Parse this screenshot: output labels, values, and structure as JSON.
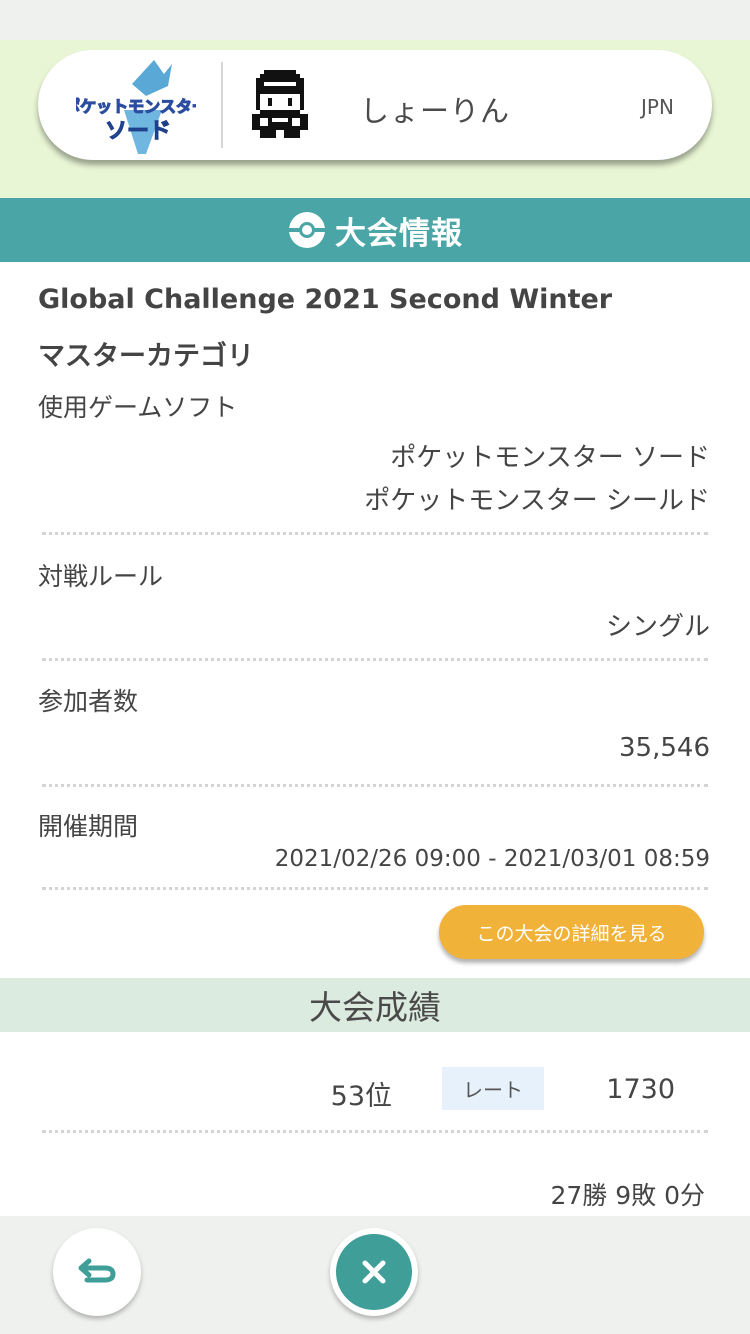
{
  "profile": {
    "game_logo_line1": "ポケットモンスター",
    "game_logo_line2": "ソード",
    "player_name": "しょーりん",
    "region": "JPN"
  },
  "section": {
    "title": "大会情報"
  },
  "tournament": {
    "name": "Global Challenge 2021 Second Winter",
    "category": "マスターカテゴリ",
    "software_label": "使用ゲームソフト",
    "software_values": [
      "ポケットモンスター ソード",
      "ポケットモンスター シールド"
    ],
    "rule_label": "対戦ルール",
    "rule_value": "シングル",
    "participants_label": "参加者数",
    "participants_value": "35,546",
    "period_label": "開催期間",
    "period_value": "2021/02/26 09:00 - 2021/03/01 08:59",
    "detail_button": "この大会の詳細を見る"
  },
  "results": {
    "title": "大会成績",
    "rank": "53位",
    "rate_label": "レート",
    "rate_value": "1730",
    "record": "27勝 9敗 0分"
  },
  "colors": {
    "teal": "#4aa6a6",
    "header_green": "#e8f6d5",
    "button_orange": "#f1b23a",
    "results_band": "#dcebe0"
  },
  "icons": [
    "pokeball-icon",
    "back-arrow-icon",
    "close-icon",
    "trainer-sprite-icon"
  ]
}
